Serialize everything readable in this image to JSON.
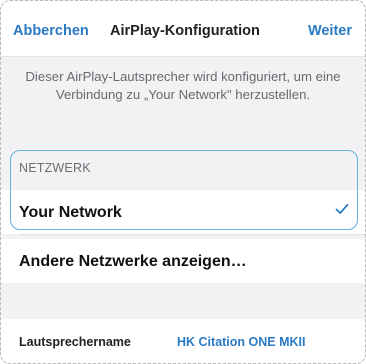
{
  "navbar": {
    "cancel_label": "Abberchen",
    "title": "AirPlay-Konfiguration",
    "next_label": "Weiter"
  },
  "description": "Dieser AirPlay-Lautsprecher wird konfiguriert, um eine Verbindung zu „Your Network\" herzustellen.",
  "network_section": {
    "header": "NETZWERK",
    "selected_network": "Your Network",
    "other_networks_label": "Andere Netzwerke anzeigen…"
  },
  "speaker": {
    "label": "Lautsprechername",
    "value": "HK Citation ONE MKII"
  },
  "colors": {
    "accent": "#2a7ac4",
    "highlight_border": "#62b1df",
    "background": "#f2f2f4"
  },
  "icons": {
    "selected": "checkmark-icon"
  }
}
